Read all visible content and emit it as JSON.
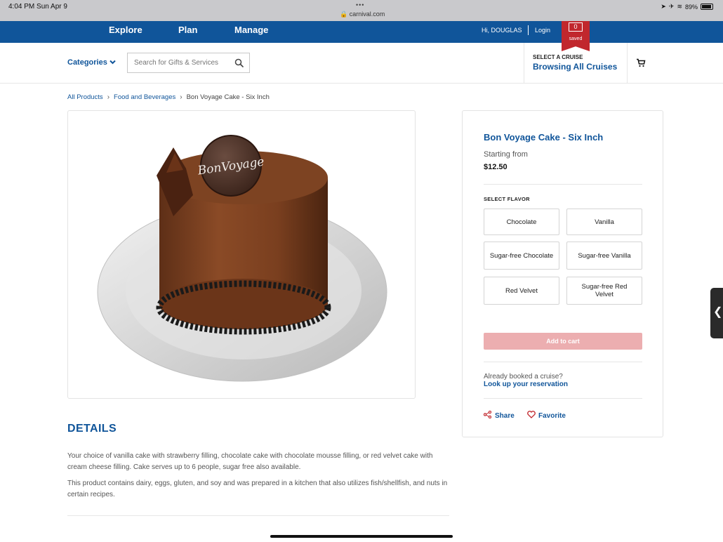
{
  "status_bar": {
    "time": "4:04 PM  Sun Apr 9",
    "dots": "•••",
    "url": "🔒 carnival.com",
    "battery": "89%"
  },
  "nav": {
    "explore": "Explore",
    "plan": "Plan",
    "manage": "Manage",
    "greeting": "Hi, DOUGLAS",
    "login": "Login",
    "saved_count": "0",
    "saved_label": "saved"
  },
  "subheader": {
    "categories": "Categories",
    "search_placeholder": "Search for Gifts & Services",
    "cruise_label": "SELECT A CRUISE",
    "cruise_value": "Browsing All Cruises"
  },
  "breadcrumb": {
    "items": [
      "All Products",
      "Food and Beverages"
    ],
    "current": "Bon Voyage Cake - Six Inch"
  },
  "product": {
    "image_text": "BonVoyage",
    "title": "Bon Voyage Cake - Six Inch",
    "starting_from": "Starting from",
    "price": "$12.50",
    "select_flavor_label": "SELECT FLAVOR",
    "flavors": [
      "Chocolate",
      "Vanilla",
      "Sugar-free Chocolate",
      "Sugar-free Vanilla",
      "Red Velvet",
      "Sugar-free Red Velvet"
    ],
    "add_to_cart": "Add to cart",
    "booked_question": "Already booked a cruise?",
    "booked_link": "Look up your reservation",
    "share": "Share",
    "favorite": "Favorite"
  },
  "details": {
    "heading": "DETAILS",
    "p1": "Your choice of vanilla cake with strawberry filling, chocolate cake with chocolate mousse filling, or red velvet cake with cream cheese filling. Cake serves up to 6 people, sugar free also available.",
    "p2": "This product contains dairy, eggs, gluten, and soy and was prepared in a kitchen that also utilizes fish/shellfish, and nuts in certain recipes."
  },
  "colors": {
    "brand_blue": "#10559a",
    "saved_red": "#c1272d",
    "add_cart_disabled": "#ecaeb0"
  },
  "side_tab_glyph": "❮"
}
